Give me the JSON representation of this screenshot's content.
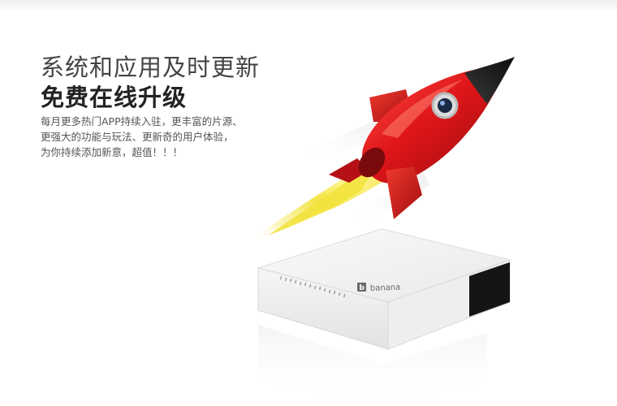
{
  "headline": {
    "line1": "系统和应用及时更新",
    "line2": "免费在线升级"
  },
  "description": {
    "lines": [
      "每月更多热门APP持续入驻，更丰富的片源、",
      "更强大的功能与玩法、更新奇的用户体验，",
      "为你持续添加新意，超值！！！"
    ]
  },
  "device": {
    "brand_text": "banana",
    "brand_mark": "b"
  },
  "colors": {
    "rocket_red": "#d8161b",
    "flame_yellow": "#f5e14a",
    "device_white": "#f4f4f4"
  }
}
